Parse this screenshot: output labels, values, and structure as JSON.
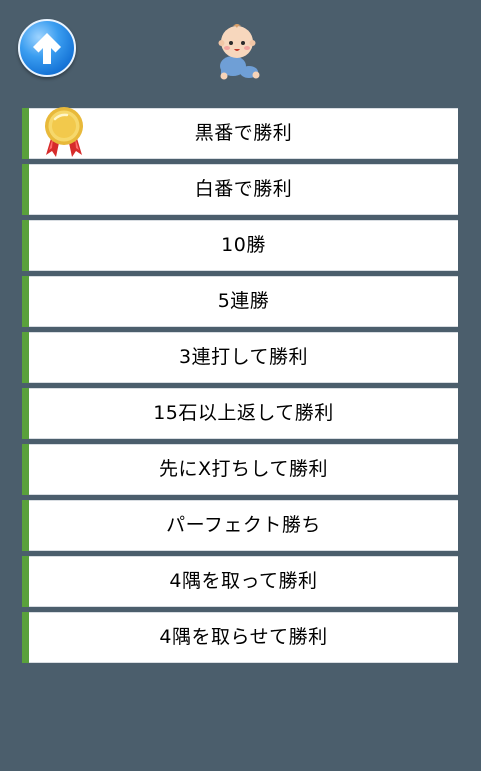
{
  "header": {
    "back_button_icon": "arrow-up-icon",
    "mascot_icon": "baby-crawling-icon"
  },
  "colors": {
    "background": "#4b5e6c",
    "item_background": "#ffffff",
    "item_accent": "#5aa13c",
    "button_blue": "#1573d6",
    "medal_gold": "#f2c94c",
    "ribbon_red": "#d62b2b"
  },
  "achievements": [
    {
      "label": "黒番で勝利",
      "achieved": true,
      "icon": "medal-icon"
    },
    {
      "label": "白番で勝利",
      "achieved": false
    },
    {
      "label": "10勝",
      "achieved": false
    },
    {
      "label": "5連勝",
      "achieved": false
    },
    {
      "label": "3連打して勝利",
      "achieved": false
    },
    {
      "label": "15石以上返して勝利",
      "achieved": false
    },
    {
      "label": "先にX打ちして勝利",
      "achieved": false
    },
    {
      "label": "パーフェクト勝ち",
      "achieved": false
    },
    {
      "label": "4隅を取って勝利",
      "achieved": false
    },
    {
      "label": "4隅を取らせて勝利",
      "achieved": false
    }
  ]
}
